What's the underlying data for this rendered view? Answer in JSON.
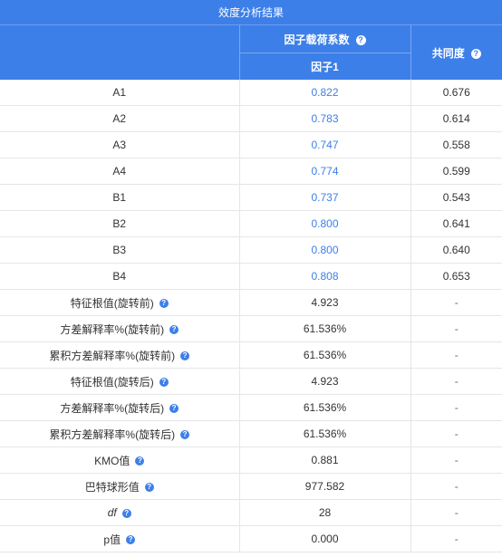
{
  "title": "效度分析结果",
  "headers": {
    "factor_loading": "因子载荷系数",
    "factor1": "因子1",
    "commonality": "共同度",
    "help_glyph": "?"
  },
  "rows": [
    {
      "label": "A1",
      "loading": "0.822",
      "commonality": "0.676"
    },
    {
      "label": "A2",
      "loading": "0.783",
      "commonality": "0.614"
    },
    {
      "label": "A3",
      "loading": "0.747",
      "commonality": "0.558"
    },
    {
      "label": "A4",
      "loading": "0.774",
      "commonality": "0.599"
    },
    {
      "label": "B1",
      "loading": "0.737",
      "commonality": "0.543"
    },
    {
      "label": "B2",
      "loading": "0.800",
      "commonality": "0.641"
    },
    {
      "label": "B3",
      "loading": "0.800",
      "commonality": "0.640"
    },
    {
      "label": "B4",
      "loading": "0.808",
      "commonality": "0.653"
    }
  ],
  "stats": [
    {
      "label": "特征根值(旋转前)",
      "value": "4.923",
      "commonality": "-"
    },
    {
      "label": "方差解释率%(旋转前)",
      "value": "61.536%",
      "commonality": "-"
    },
    {
      "label": "累积方差解释率%(旋转前)",
      "value": "61.536%",
      "commonality": "-"
    },
    {
      "label": "特征根值(旋转后)",
      "value": "4.923",
      "commonality": "-"
    },
    {
      "label": "方差解释率%(旋转后)",
      "value": "61.536%",
      "commonality": "-"
    },
    {
      "label": "累积方差解释率%(旋转后)",
      "value": "61.536%",
      "commonality": "-"
    },
    {
      "label": "KMO值",
      "value": "0.881",
      "commonality": "-"
    },
    {
      "label": "巴特球形值",
      "value": "977.582",
      "commonality": "-"
    },
    {
      "label": "df",
      "value": "28",
      "commonality": "-"
    },
    {
      "label": "p值",
      "value": "0.000",
      "commonality": "-"
    }
  ],
  "colors": {
    "accent": "#3d7fe8",
    "border": "#e6e6e6",
    "text": "#333333"
  }
}
